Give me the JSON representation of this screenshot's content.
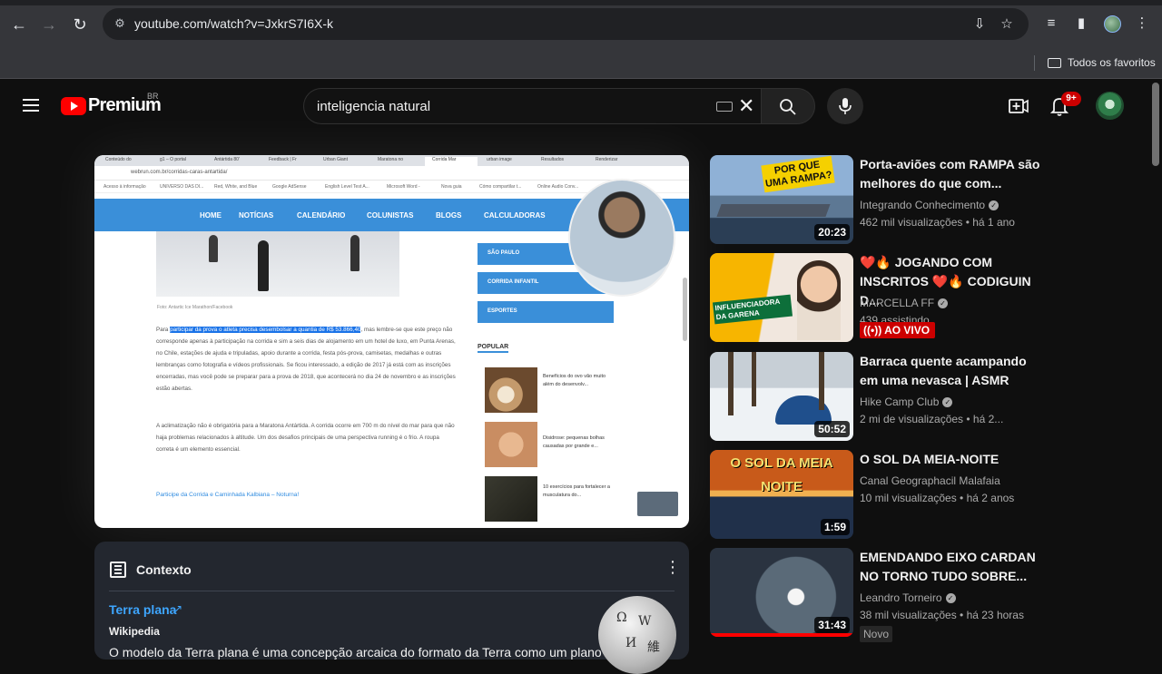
{
  "browser": {
    "url": "youtube.com/watch?v=JxkrS7I6X-k",
    "bookmarks_folder": "Todos os favoritos"
  },
  "youtube": {
    "logo_text": "Premium",
    "region": "BR",
    "search_query": "inteligencia natural",
    "notification_count": "9+",
    "colors": {
      "brand_red": "#ff0000",
      "link_blue": "#3ea6ff",
      "bg": "#0f0f0f"
    }
  },
  "video_frame": {
    "tabs": [
      "Conteúdo do",
      "g1 – O portal",
      "Antártida 80'",
      "Feedback | Fr",
      "Urban Giant",
      "Maratona no",
      "Corrida Mar",
      "urban image",
      "Resultados",
      "Renderizar"
    ],
    "url": "webrun.com.br/corridas-caras-antartida/",
    "bookmarks": [
      "Acesso à informação",
      "UNIVERSO DAS DI...",
      "Red, White, and Blue",
      "Google AdSense",
      "English Level Test A...",
      "Microsoft Word -",
      "Nova guia",
      "Cómo compartilar t...",
      "Online Audio Conv..."
    ],
    "nav": [
      "HOME",
      "NOTÍCIAS",
      "CALENDÁRIO",
      "COLUNISTAS",
      "BLOGS",
      "CALCULADORAS"
    ],
    "caption": "Foto: Antartic Ice Marathon/Facebook",
    "p1_prefix": "Para",
    "p1_highlight": "participar da prova o atleta precisa desembolsar a quantia de R$ 53.866,40",
    "p1_rest": ", mas lembre-se que este preço não corresponde apenas à participação na corrida e sim a seis dias de alojamento em um hotel de luxo, em Punta Arenas, no Chile, estações de ajuda e tripuladas, apoio durante a corrida, festa pós-prova, camisetas, medalhas e outras lembranças como fotografia e vídeos profissionais. Se ficou interessado, a edição de 2017 já está com as inscrições encerradas, mas você pode se preparar para a prova de 2018, que acontecerá no dia 24 de novembro e as inscrições estão abertas.",
    "p2": "A aclimatização não é obrigatória para a Maratona Antártida. A corrida ocorre em 700 m do nível do mar para que não haja problemas relacionados à altitude. Um dos desafios principais de uma perspectiva running é o frio. A roupa correta é um elemento essencial.",
    "link": "Participe da Corrida e Caminhada Kalbiana – Noturna!",
    "side_buttons": [
      "SÃO PAULO",
      "CORRIDA INFANTIL",
      "ESPORTES"
    ],
    "popular_heading": "POPULAR",
    "popular": [
      "Benefícios do ovo vão muito além do desenvolv...",
      "Disidrose: pequenas bolhas causadas por grande e...",
      "10 exercícios para fortalecer a musculatura do..."
    ]
  },
  "contexto": {
    "heading": "Contexto",
    "link": "Terra plana",
    "source": "Wikipedia",
    "description": "O modelo da Terra plana é uma concepção arcaica do formato da Terra como um plano ou"
  },
  "recommendations": [
    {
      "title": "Porta-aviões com RAMPA são melhores do que com...",
      "channel": "Integrando Conhecimento",
      "verified": true,
      "meta": "462 mil visualizações  •  há 1 ano",
      "duration": "20:23",
      "thumb_text": "POR QUE UMA RAMPA?"
    },
    {
      "title": "❤️🔥 JOGANDO COM INSCRITOS ❤️🔥 CODIGUIN D...",
      "channel": "MARCELLA FF",
      "verified": true,
      "meta": "439 assistindo",
      "live": "AO VIVO",
      "thumb_text": "INFLUENCIADORA DA GARENA"
    },
    {
      "title": "Barraca quente acampando em uma nevasca | ASMR",
      "channel": "Hike Camp Club",
      "verified": true,
      "meta": "2 mi de visualizações  •  há 2...",
      "duration": "50:52"
    },
    {
      "title": "O SOL DA MEIA-NOITE",
      "channel": "Canal Geographacil Malafaia",
      "verified": false,
      "meta": "10 mil visualizações  •  há 2 anos",
      "duration": "1:59",
      "thumb_text": "O SOL DA MEIA NOITE"
    },
    {
      "title": "EMENDANDO EIXO CARDAN NO TORNO TUDO SOBRE...",
      "channel": "Leandro Torneiro",
      "verified": true,
      "meta": "38 mil visualizações  •  há 23 horas",
      "duration": "31:43",
      "badge": "Novo"
    }
  ]
}
